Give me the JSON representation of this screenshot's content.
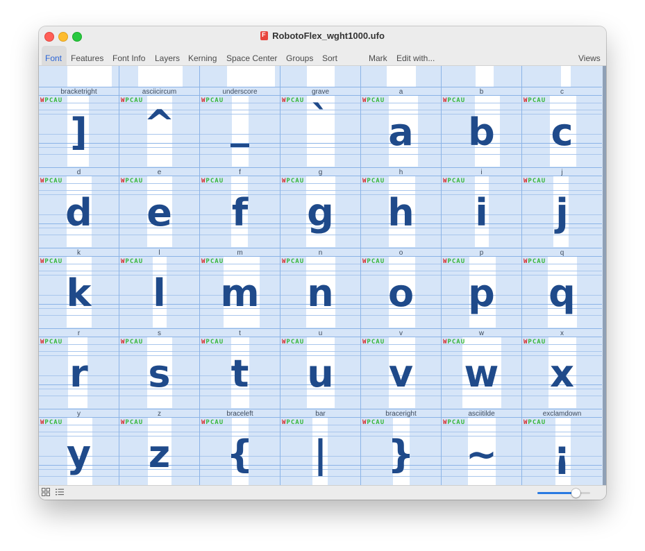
{
  "window": {
    "title": "RobotoFlex_wght1000.ufo"
  },
  "toolbar": {
    "items": [
      "Font",
      "Features",
      "Font Info",
      "Layers",
      "Kerning",
      "Space Center",
      "Groups",
      "Sort",
      "Mark",
      "Edit with...",
      "Views"
    ],
    "active": "Font"
  },
  "top_row_labels": [
    "bracketright",
    "asciicircum",
    "underscore",
    "grave",
    "a",
    "b",
    "c"
  ],
  "rows": [
    {
      "glyphs": [
        {
          "name": "bracketright",
          "char": "]"
        },
        {
          "name": "asciicircum",
          "char": "^"
        },
        {
          "name": "underscore",
          "char": "_"
        },
        {
          "name": "grave",
          "char": "`"
        },
        {
          "name": "a",
          "char": "a"
        },
        {
          "name": "b",
          "char": "b"
        },
        {
          "name": "c",
          "char": "c"
        }
      ]
    },
    {
      "glyphs": [
        {
          "name": "d",
          "char": "d"
        },
        {
          "name": "e",
          "char": "e"
        },
        {
          "name": "f",
          "char": "f"
        },
        {
          "name": "g",
          "char": "g"
        },
        {
          "name": "h",
          "char": "h"
        },
        {
          "name": "i",
          "char": "i"
        },
        {
          "name": "j",
          "char": "j"
        }
      ]
    },
    {
      "glyphs": [
        {
          "name": "k",
          "char": "k"
        },
        {
          "name": "l",
          "char": "l"
        },
        {
          "name": "m",
          "char": "m"
        },
        {
          "name": "n",
          "char": "n"
        },
        {
          "name": "o",
          "char": "o"
        },
        {
          "name": "p",
          "char": "p"
        },
        {
          "name": "q",
          "char": "q"
        }
      ]
    },
    {
      "glyphs": [
        {
          "name": "r",
          "char": "r"
        },
        {
          "name": "s",
          "char": "s"
        },
        {
          "name": "t",
          "char": "t"
        },
        {
          "name": "u",
          "char": "u"
        },
        {
          "name": "v",
          "char": "v"
        },
        {
          "name": "w",
          "char": "w"
        },
        {
          "name": "x",
          "char": "x"
        }
      ]
    },
    {
      "glyphs": [
        {
          "name": "y",
          "char": "y"
        },
        {
          "name": "z",
          "char": "z"
        },
        {
          "name": "braceleft",
          "char": "{"
        },
        {
          "name": "bar",
          "char": "|"
        },
        {
          "name": "braceright",
          "char": "}"
        },
        {
          "name": "asciitilde",
          "char": "~"
        },
        {
          "name": "exclamdown",
          "char": "¡"
        }
      ]
    }
  ],
  "flags": {
    "w": "W",
    "p": "P",
    "c": "C",
    "a": "A",
    "u": "U"
  },
  "statusbar": {
    "grid_view_icon": "grid-icon",
    "list_view_icon": "list-icon",
    "zoom_slider_level": 0.72
  },
  "colors": {
    "glyph": "#1f4a8a",
    "cell_bg": "#d6e5f8",
    "advance_bg": "#ffffff",
    "flag_red": "#d62b2b",
    "flag_green": "#36b63a",
    "accent": "#2a64d6"
  }
}
